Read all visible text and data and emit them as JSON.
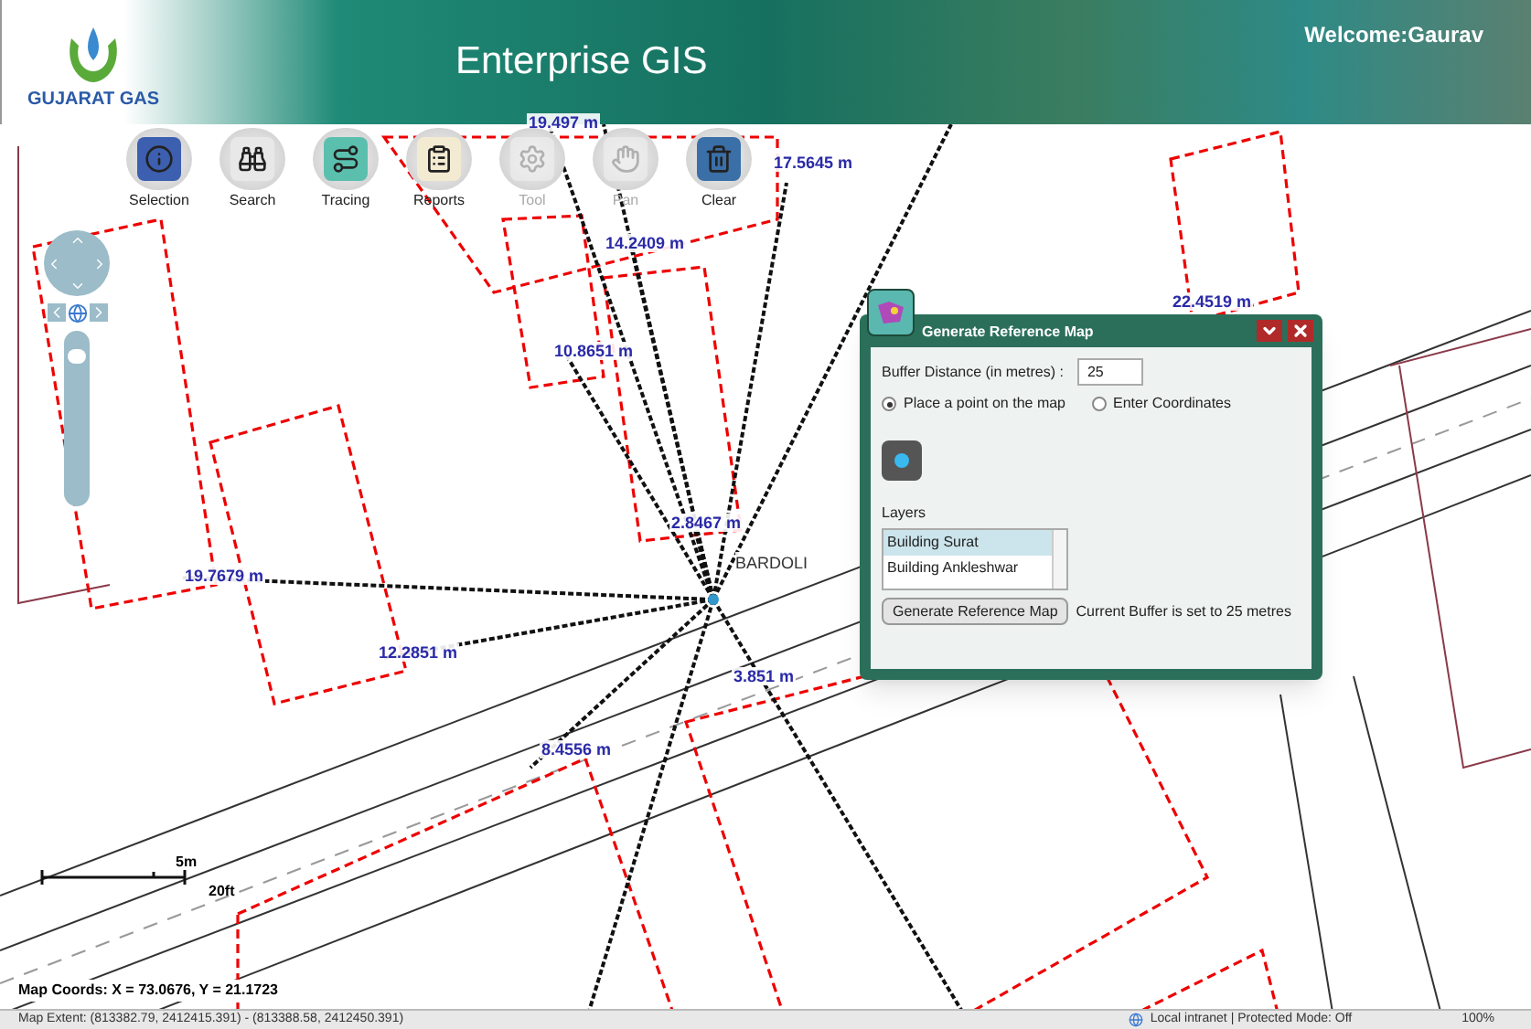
{
  "header": {
    "logo_text": "GUJARAT GAS",
    "title": "Enterprise GIS",
    "welcome": "Welcome:Gaurav"
  },
  "toolbar": [
    {
      "label": "Selection",
      "disabled": false
    },
    {
      "label": "Search",
      "disabled": false
    },
    {
      "label": "Tracing",
      "disabled": false
    },
    {
      "label": "Reports",
      "disabled": false
    },
    {
      "label": "Tool",
      "disabled": true
    },
    {
      "label": "Pan",
      "disabled": true
    },
    {
      "label": "Clear",
      "disabled": false
    }
  ],
  "zoom": {
    "level": 0.88
  },
  "map": {
    "place_label": "BARDOLI",
    "measurements": [
      "19.497 m",
      "17.5645 m",
      "14.2409 m",
      "10.8651 m",
      "2.8467 m",
      "19.7679 m",
      "12.2851 m",
      "3.851 m",
      "8.4556 m",
      "22.4519 m"
    ]
  },
  "scale": {
    "metric": "5m",
    "imperial": "20ft"
  },
  "dialog": {
    "title": "Generate Reference Map",
    "buffer_label": "Buffer Distance (in metres) :",
    "buffer_value": "25",
    "options": [
      {
        "label": "Place a point on the map",
        "selected": true
      },
      {
        "label": "Enter Coordinates",
        "selected": false
      }
    ],
    "layers_label": "Layers",
    "layers": [
      {
        "label": "Building Surat",
        "selected": true
      },
      {
        "label": "Building Ankleshwar",
        "selected": false
      }
    ],
    "button": "Generate Reference Map",
    "status": "Current Buffer is set to 25 metres"
  },
  "coords": "Map Coords: X = 73.0676, Y = 21.1723",
  "status_bar": {
    "extent": "Map Extent: (813382.79, 2412415.391) - (813388.58, 2412450.391)",
    "zone": "Local intranet | Protected Mode: Off",
    "zoom": "100%"
  }
}
